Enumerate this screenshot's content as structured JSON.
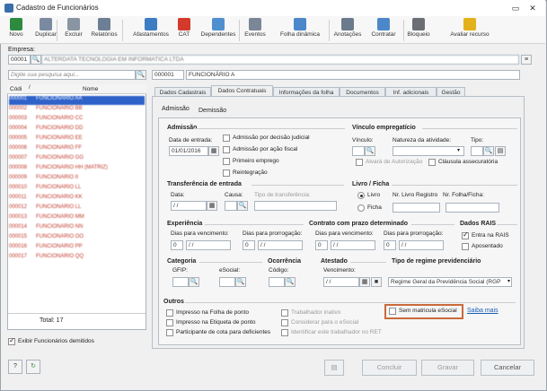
{
  "window": {
    "title": "Cadastro de Funcionários"
  },
  "toolbar": {
    "items": [
      {
        "label": "Novo",
        "color": "#2d8a3e"
      },
      {
        "label": "Duplicar",
        "color": "#7a8aa0"
      },
      {
        "label": "Excluir",
        "color": "#8a95a3"
      },
      {
        "label": "Relatórios",
        "color": "#6d7f95"
      },
      {
        "label": "Afastamentos",
        "color": "#3e7cc4"
      },
      {
        "label": "CAT",
        "color": "#d33a2c"
      },
      {
        "label": "Dependentes",
        "color": "#4f8fd0"
      },
      {
        "label": "Eventos",
        "color": "#7b8797"
      },
      {
        "label": "Folha dinâmica",
        "color": "#4c87c9"
      },
      {
        "label": "Anotações",
        "color": "#6b7a8c"
      },
      {
        "label": "Contratar",
        "color": "#4c87c9"
      },
      {
        "label": "Bloqueio",
        "color": "#6b6f75"
      },
      {
        "label": "Avaliar recurso",
        "color": "#e3b21a"
      }
    ]
  },
  "empresa": {
    "label": "Empresa:",
    "code": "00001",
    "name": "ALTERDATA TECNOLOGIA EM INFORMATICA LTDA"
  },
  "search": {
    "placeholder": "Digite sua pesquisa aqui...",
    "code": "000001",
    "name": "FUNCIONÁRIO A"
  },
  "list": {
    "headers": {
      "code": "Códi",
      "name": "Nome"
    },
    "rows": [
      {
        "code": "000001",
        "name": "FUNCIONÁRIO AA"
      },
      {
        "code": "000002",
        "name": "FUNCIONÁRIO BB"
      },
      {
        "code": "000003",
        "name": "FUNCIONÁRIO CC"
      },
      {
        "code": "000004",
        "name": "FUNCIONÁRIO DD"
      },
      {
        "code": "000005",
        "name": "FUNCIONÁRIO EE"
      },
      {
        "code": "000006",
        "name": "FUNCIONÁRIO FF"
      },
      {
        "code": "000007",
        "name": "FUNCIONÁRIO GG"
      },
      {
        "code": "000008",
        "name": "FUNCIONÁRIO HH (MATRIZ)"
      },
      {
        "code": "000009",
        "name": "FUNCIONÁRIO II"
      },
      {
        "code": "000010",
        "name": "FUNCIONÁRIO LL"
      },
      {
        "code": "000011",
        "name": "FUNCIONÁRIO KK"
      },
      {
        "code": "000012",
        "name": "FUNCIONÁRIO LL"
      },
      {
        "code": "000013",
        "name": "FUNCIONÁRIO MM"
      },
      {
        "code": "000014",
        "name": "FUNCIONÁRIO NN"
      },
      {
        "code": "000015",
        "name": "FUNCIONÁRIO OO"
      },
      {
        "code": "000016",
        "name": "FUNCIONÁRIO PP"
      },
      {
        "code": "000017",
        "name": "FUNCIONÁRIO QQ"
      }
    ],
    "total": "Total: 17"
  },
  "exibir": "Exibir Funcionários demitidos",
  "tabs": [
    "Dados Cadastrais",
    "Dados Contratuais",
    "Informações da folha",
    "Documentos",
    "Inf. adicionais",
    "Gestão"
  ],
  "subtabs": [
    "Admissão",
    "Demissão"
  ],
  "admissao": {
    "title": "Admissão",
    "data_label": "Data de entrada:",
    "data_value": "01/01/2016",
    "opts": [
      "Admissão por decisão judicial",
      "Admissão por ação fiscal",
      "Primeiro emprego",
      "Reintegração"
    ]
  },
  "vinculo": {
    "title": "Vínculo empregatício",
    "vinculo_label": "Vínculo:",
    "natureza_label": "Natureza da atividade:",
    "tipo_label": "Tipo:",
    "alvara": "Alvará de Autorização",
    "clausula": "Cláusula assecuratória"
  },
  "transferencia": {
    "title": "Transferência de entrada",
    "data": "Data:",
    "data_value": "/ /",
    "causa": "Causa:",
    "tipo": "Tipo de transferência:"
  },
  "livro": {
    "title": "Livro / Ficha",
    "livro": "Livro",
    "ficha": "Ficha",
    "nr_livro": "Nr. Livro Registro",
    "nr_folha": "Nr. Folha/Ficha:"
  },
  "experiencia": {
    "title": "Experiência",
    "venc": "Dias para vencimento:",
    "prorr": "Dias para prorrogação:",
    "zero": "0",
    "date": "/ /"
  },
  "contrato": {
    "title": "Contrato com prazo determinado",
    "venc": "Dias para vencimento:",
    "prorr": "Dias para prorrogação:",
    "zero": "0",
    "date": "/ /"
  },
  "rais": {
    "title": "Dados RAIS",
    "entra": "Entra na RAIS",
    "aposentado": "Aposentado"
  },
  "categoria": {
    "title": "Categoria",
    "gfip": "GFIP:",
    "esocial": "eSocial:"
  },
  "ocorrencia": {
    "title": "Ocorrência",
    "codigo": "Código:"
  },
  "atestado": {
    "title": "Atestado",
    "venc": "Vencimento:",
    "date": "/ /"
  },
  "regime": {
    "title": "Tipo de regime previdenciário",
    "value": "Regime Geral da Previdência Social (RGP"
  },
  "outros": {
    "title": "Outros",
    "col1": [
      "Impresso na Folha de ponto",
      "Impresso na Etiqueta de ponto",
      "Participante de cota para deficientes"
    ],
    "col2": [
      "Trabalhador inativo",
      "Considerar para o eSocial",
      "Identificar este trabalhador no RET"
    ],
    "sem_matricula": "Sem matricula eSocial",
    "saiba": "Saiba mais"
  },
  "buttons": {
    "concluir": "Concluir",
    "gravar": "Gravar",
    "cancelar": "Cancelar"
  }
}
